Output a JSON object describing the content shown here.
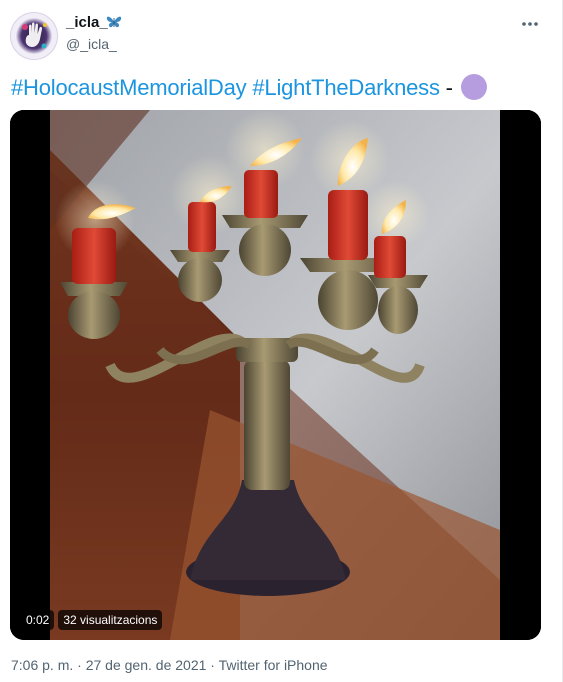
{
  "author": {
    "display_name": "_icla_",
    "handle": "@_icla_",
    "name_emoji": "blue-butterfly-emoji",
    "avatar": "purple-handprint-avatar"
  },
  "menu": {
    "icon": "more-options-icon"
  },
  "tweet": {
    "hashtag_1": "#HolocaustMemorialDay",
    "hashtag_2": "#LightTheDarkness",
    "dash": "-",
    "emoji": "purple-circle-emoji"
  },
  "video": {
    "description": "Lit red candles on a brass candelabra on a staircase",
    "time": "0:02",
    "views": "32 visualitzacions"
  },
  "footer": {
    "time": "7:06 p. m.",
    "separator_1": " · ",
    "date": "27 de gen. de 2021",
    "separator_2": " · ",
    "source": "Twitter for iPhone"
  },
  "colors": {
    "hashtag": "#1b95e0",
    "purple_dot": "#b69ddf",
    "meta_text": "#536471"
  }
}
